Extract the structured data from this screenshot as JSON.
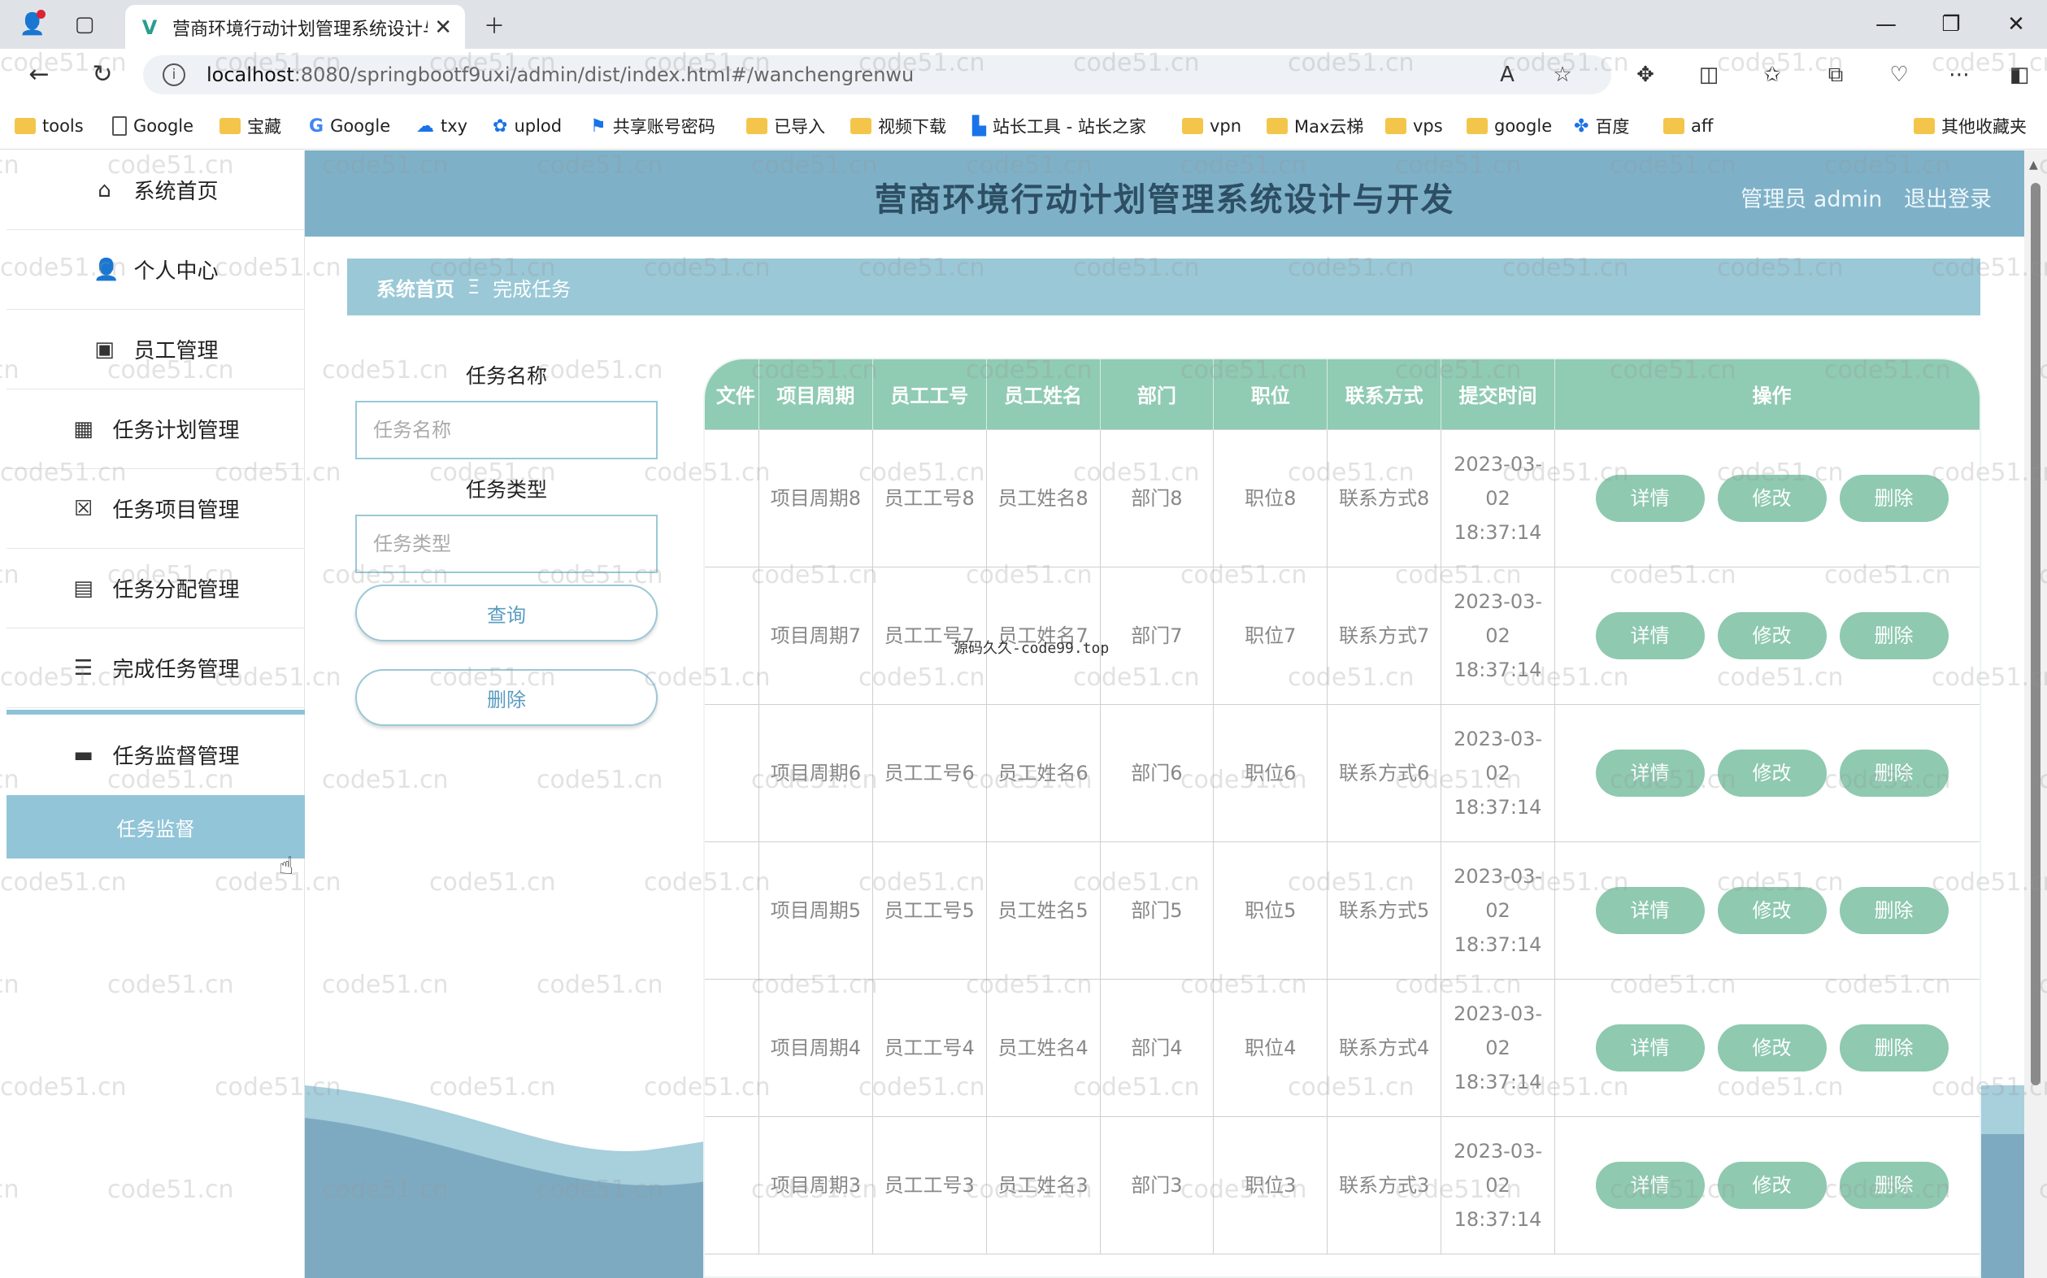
{
  "browser": {
    "tab_title": "营商环境行动计划管理系统设计与",
    "url_host": "localhost",
    "url_path": ":8080/springbootf9uxi/admin/dist/index.html#/wanchengrenwu",
    "bookmarks": [
      "tools",
      "Google",
      "宝藏",
      "Google",
      "txy",
      "uplod",
      "共享账号密码",
      "已导入",
      "视频下载",
      "站长工具 - 站长之家",
      "vpn",
      "Max云梯",
      "vps",
      "google",
      "百度",
      "aff",
      "其他收藏夹"
    ]
  },
  "sidebar": {
    "items": [
      {
        "label": "系统首页",
        "icon": "home-icon"
      },
      {
        "label": "个人中心",
        "icon": "user-icon"
      },
      {
        "label": "员工管理",
        "icon": "wallet-icon"
      },
      {
        "label": "任务计划管理",
        "icon": "grid-icon"
      },
      {
        "label": "任务项目管理",
        "icon": "clipboard-icon"
      },
      {
        "label": "任务分配管理",
        "icon": "chat-icon"
      },
      {
        "label": "完成任务管理",
        "icon": "list-icon"
      },
      {
        "label": "任务监督管理",
        "icon": "monitor-icon"
      }
    ],
    "submenu_label": "任务监督"
  },
  "header": {
    "title": "营商环境行动计划管理系统设计与开发",
    "role": "管理员 admin",
    "logout": "退出登录"
  },
  "breadcrumb": {
    "home": "系统首页",
    "sep": "Ξ",
    "current": "完成任务"
  },
  "search": {
    "name_label": "任务名称",
    "name_placeholder": "任务名称",
    "type_label": "任务类型",
    "type_placeholder": "任务类型",
    "query_btn": "查询",
    "delete_btn": "删除"
  },
  "table": {
    "columns": [
      "文件",
      "项目周期",
      "员工工号",
      "员工姓名",
      "部门",
      "职位",
      "联系方式",
      "提交时间",
      "操作"
    ],
    "rows": [
      {
        "file": "",
        "cycle": "项目周期8",
        "emp_no": "员工工号8",
        "emp_name": "员工姓名8",
        "dept": "部门8",
        "pos": "职位8",
        "contact": "联系方式8",
        "time": "2023-03-02 18:37:14"
      },
      {
        "file": "",
        "cycle": "项目周期7",
        "emp_no": "员工工号7",
        "emp_name": "员工姓名7",
        "dept": "部门7",
        "pos": "职位7",
        "contact": "联系方式7",
        "time": "2023-03-02 18:37:14"
      },
      {
        "file": "",
        "cycle": "项目周期6",
        "emp_no": "员工工号6",
        "emp_name": "员工姓名6",
        "dept": "部门6",
        "pos": "职位6",
        "contact": "联系方式6",
        "time": "2023-03-02 18:37:14"
      },
      {
        "file": "",
        "cycle": "项目周期5",
        "emp_no": "员工工号5",
        "emp_name": "员工姓名5",
        "dept": "部门5",
        "pos": "职位5",
        "contact": "联系方式5",
        "time": "2023-03-02 18:37:14"
      },
      {
        "file": "",
        "cycle": "项目周期4",
        "emp_no": "员工工号4",
        "emp_name": "员工姓名4",
        "dept": "部门4",
        "pos": "职位4",
        "contact": "联系方式4",
        "time": "2023-03-02 18:37:14"
      },
      {
        "file": "",
        "cycle": "项目周期3",
        "emp_no": "员工工号3",
        "emp_name": "员工姓名3",
        "dept": "部门3",
        "pos": "职位3",
        "contact": "联系方式3",
        "time": "2023-03-02 18:37:14"
      }
    ],
    "actions": {
      "detail": "详情",
      "edit": "修改",
      "delete": "删除"
    }
  },
  "watermark": "code51.cn",
  "overlay_note": "源码久久-code99.top",
  "colors": {
    "topbar": "#7eb1c8",
    "accent": "#9ac8d6",
    "table_header": "#90cbb3",
    "op_button": "#8ec9b0"
  }
}
